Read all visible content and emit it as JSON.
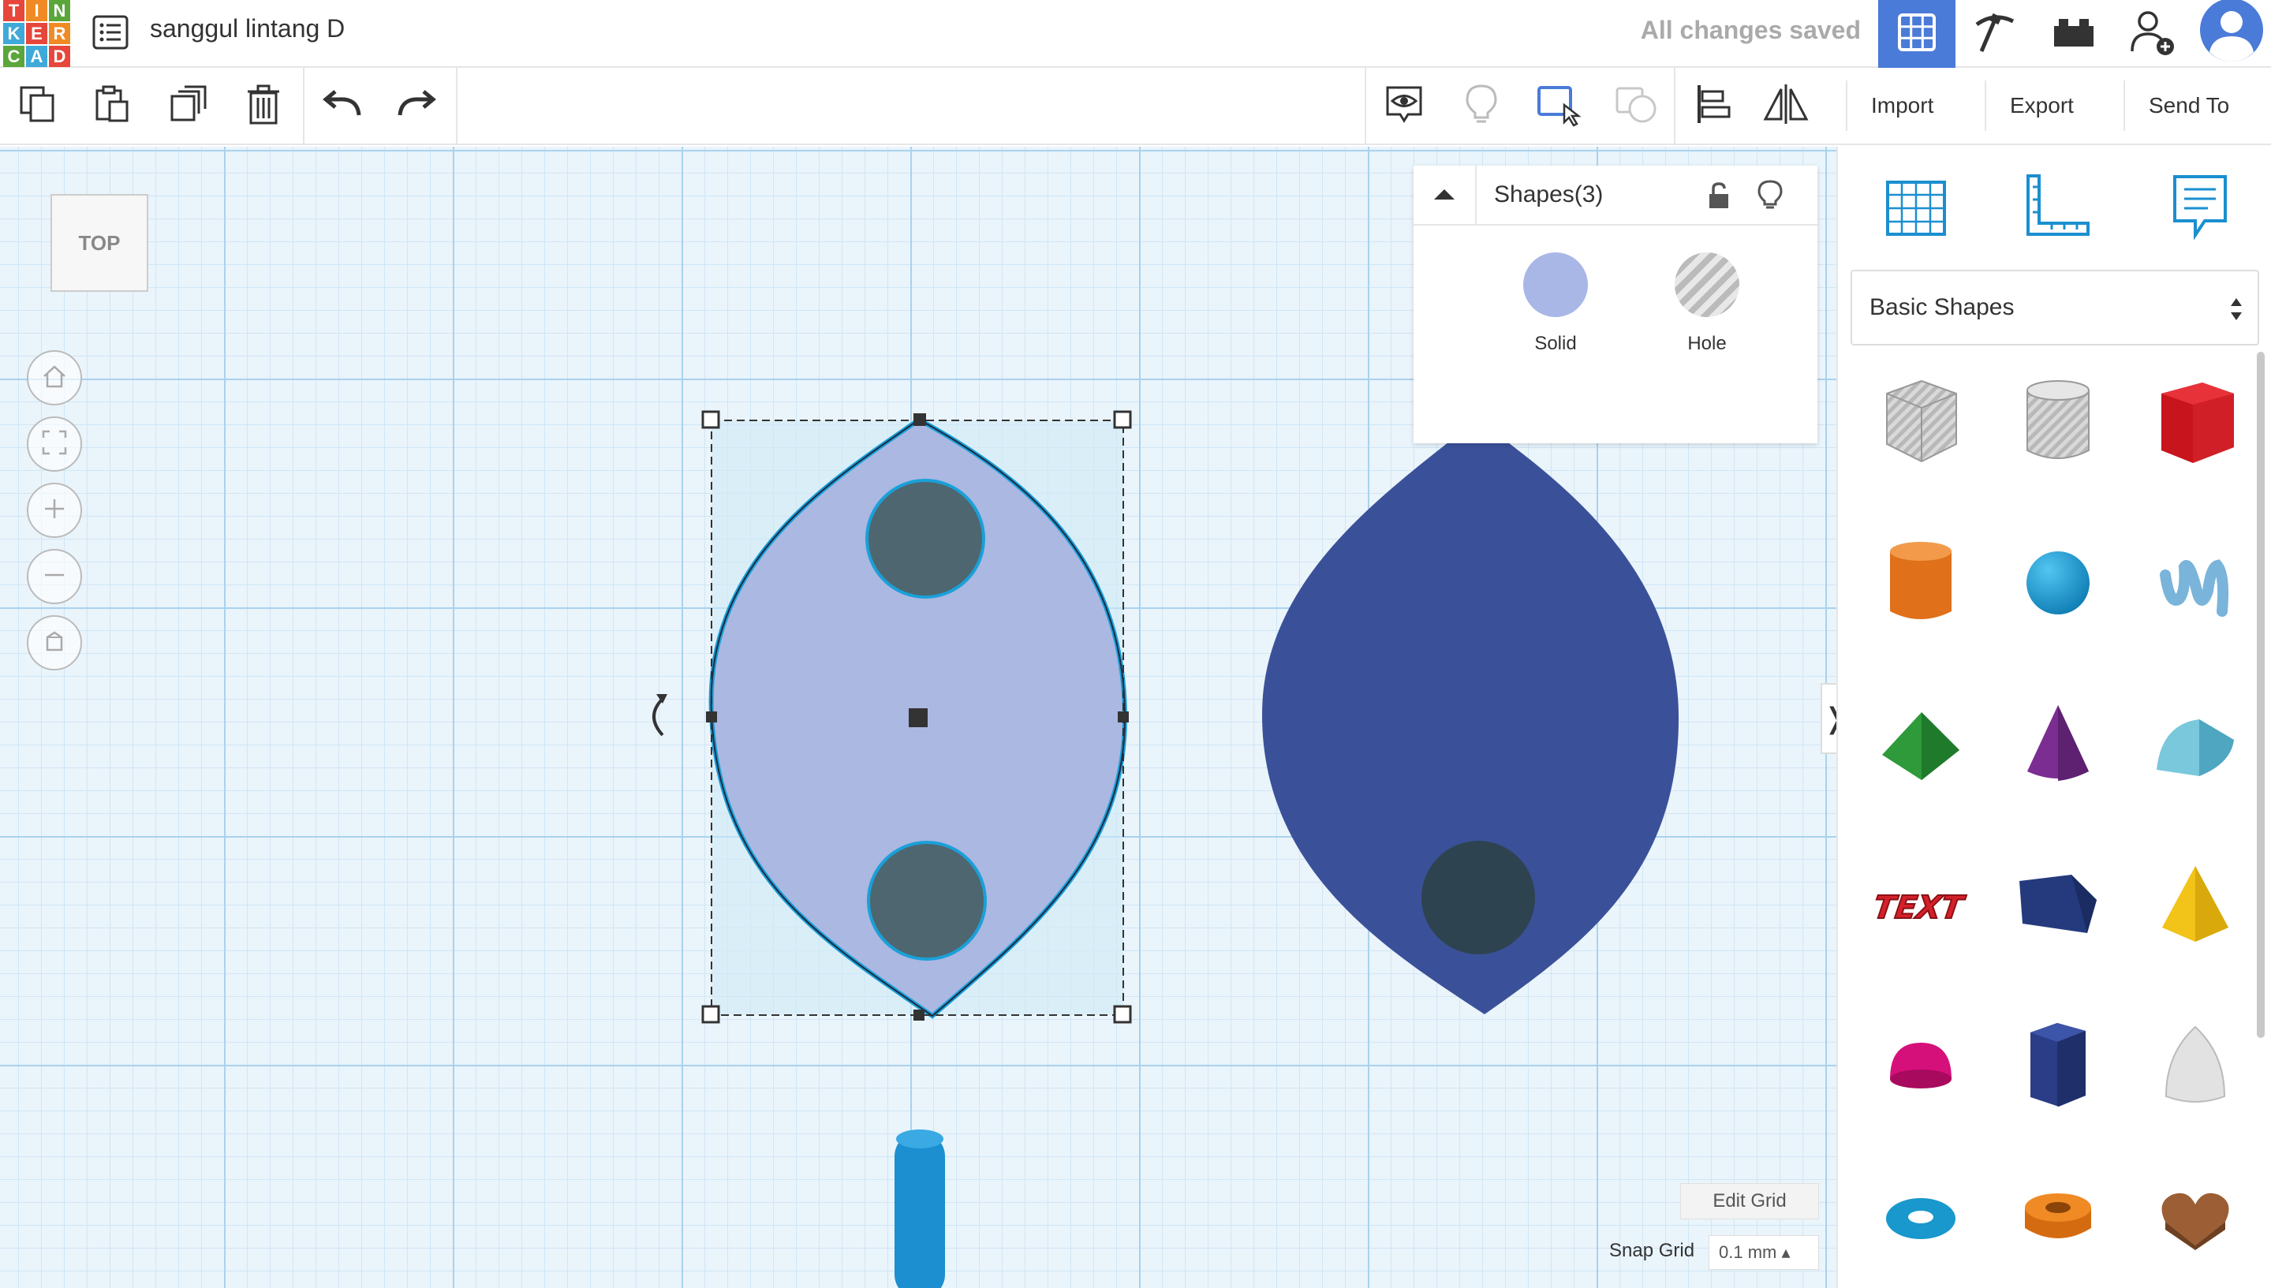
{
  "app": {
    "logo_letters": [
      "T",
      "I",
      "N",
      "K",
      "E",
      "R",
      "C",
      "A",
      "D"
    ],
    "logo_colors": [
      "#e6463b",
      "#f08a24",
      "#5aa63a",
      "#3fa9d9",
      "#e6463b",
      "#f08a24",
      "#5aa63a",
      "#3fa9d9",
      "#e6463b"
    ],
    "design_title": "sanggul lintang D",
    "save_status": "All changes saved"
  },
  "topnav": {
    "items": [
      {
        "name": "3d-view",
        "icon": "grid-icon",
        "active": true
      },
      {
        "name": "codeblocks",
        "icon": "pickaxe-icon",
        "active": false
      },
      {
        "name": "bricks",
        "icon": "brick-icon",
        "active": false
      },
      {
        "name": "invite",
        "icon": "add-user-icon",
        "active": false
      },
      {
        "name": "profile",
        "icon": "avatar-icon",
        "active": false
      }
    ]
  },
  "toolbar": {
    "copy": "copy-icon",
    "paste": "paste-icon",
    "duplicate": "duplicate-icon",
    "delete": "trash-icon",
    "undo": "undo-icon",
    "redo": "redo-icon",
    "import_label": "Import",
    "export_label": "Export",
    "send_to_label": "Send To"
  },
  "viewport": {
    "view_label": "TOP",
    "nav_controls": [
      "home-icon",
      "fit-icon",
      "zoom-in-icon",
      "zoom-out-icon",
      "ortho-icon"
    ]
  },
  "shapes_panel": {
    "title": "Shapes(3)",
    "solid_label": "Solid",
    "hole_label": "Hole",
    "solid_color": "#a9b7e6"
  },
  "sidebar": {
    "tabs": [
      "workplane-icon",
      "ruler-icon",
      "notes-icon"
    ],
    "library": "Basic Shapes",
    "shapes": [
      "box-hole",
      "cylinder-hole",
      "box",
      "cylinder",
      "sphere",
      "scribble",
      "roof",
      "cone",
      "round-roof",
      "text",
      "prism",
      "pyramid",
      "half-sphere",
      "polygon",
      "paraboloid",
      "torus",
      "tube",
      "heart"
    ]
  },
  "grid": {
    "edit_label": "Edit Grid",
    "snap_label": "Snap Grid",
    "snap_value": "0.1 mm ▴"
  },
  "colors": {
    "accent": "#4a7bd8",
    "selected_shape": "#aab8e2",
    "dark_shape": "#3a5199",
    "hole": "#4e6670",
    "cylinder_blue": "#1b8fd0"
  }
}
